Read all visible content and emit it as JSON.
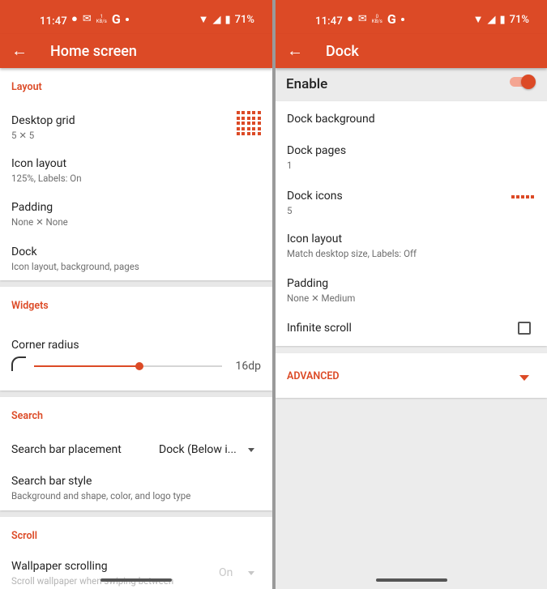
{
  "status_bar": {
    "time": "11:47",
    "battery": "71%",
    "kbs": "1\nKB/s",
    "kbs_right": "0\nKB/s",
    "google_letter": "G"
  },
  "left": {
    "title": "Home screen",
    "sections": {
      "layout": "Layout",
      "widgets": "Widgets",
      "search": "Search",
      "scroll": "Scroll"
    },
    "desktop_grid": {
      "title": "Desktop grid",
      "subtitle": "5 ✕ 5"
    },
    "icon_layout": {
      "title": "Icon layout",
      "subtitle": "125%, Labels: On"
    },
    "padding": {
      "title": "Padding",
      "subtitle": "None ✕ None"
    },
    "dock": {
      "title": "Dock",
      "subtitle": "Icon layout, background, pages"
    },
    "corner_radius": {
      "title": "Corner radius",
      "value": "16dp",
      "level": 0.56
    },
    "search_bar_placement": {
      "title": "Search bar placement",
      "value": "Dock (Below i..."
    },
    "search_bar_style": {
      "title": "Search bar style",
      "subtitle": "Background and shape, color, and logo type"
    },
    "wallpaper_scrolling": {
      "title": "Wallpaper scrolling",
      "subtitle": "Scroll wallpaper when swiping between",
      "value": "On"
    }
  },
  "right": {
    "title": "Dock",
    "enable": {
      "label": "Enable",
      "on": true
    },
    "dock_background": {
      "title": "Dock background"
    },
    "dock_pages": {
      "title": "Dock pages",
      "subtitle": "1"
    },
    "dock_icons": {
      "title": "Dock icons",
      "subtitle": "5"
    },
    "icon_layout": {
      "title": "Icon layout",
      "subtitle": "Match desktop size, Labels: Off"
    },
    "padding": {
      "title": "Padding",
      "subtitle": "None ✕ Medium"
    },
    "infinite_scroll": {
      "title": "Infinite scroll",
      "checked": false
    },
    "advanced": {
      "label": "ADVANCED"
    }
  },
  "colors": {
    "accent": "#dc4a26",
    "accent_light": "#f4a592"
  }
}
